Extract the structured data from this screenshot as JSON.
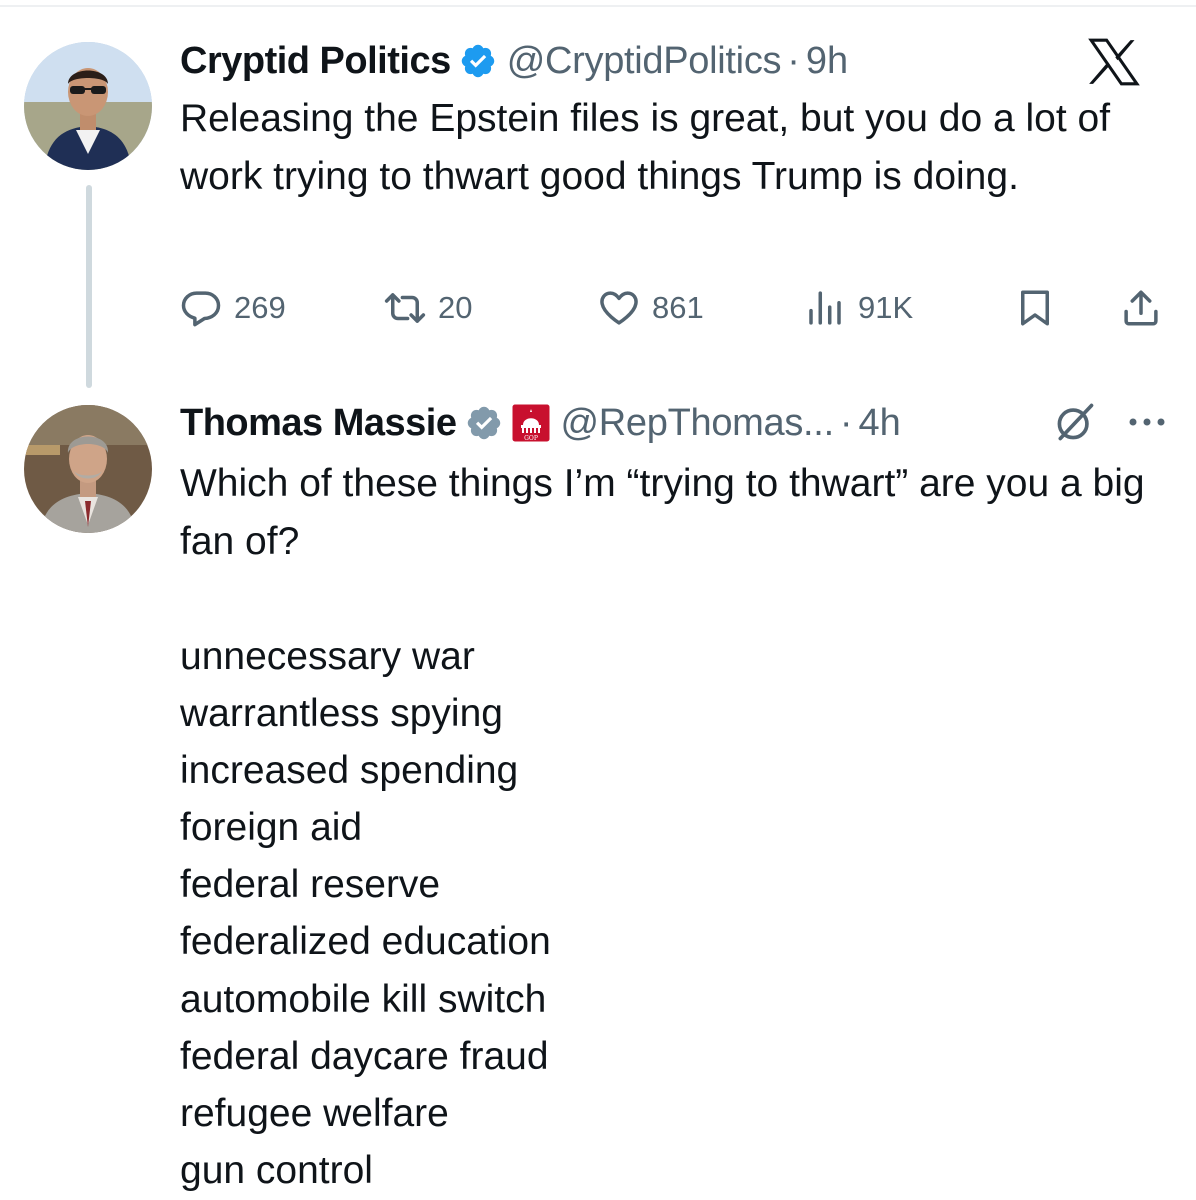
{
  "tweet1": {
    "name": "Cryptid Politics",
    "handle": "@CryptidPolitics",
    "separator": "·",
    "time": "9h",
    "text": "Releasing the Epstein files is great, but you do a lot of work trying to thwart good things Trump is doing.",
    "stats": {
      "replies": "269",
      "reposts": "20",
      "likes": "861",
      "views": "91K"
    }
  },
  "tweet2": {
    "name": "Thomas Massie",
    "handle": "@RepThomas...",
    "separator": "·",
    "time": "4h",
    "text": "Which of these things I’m “trying to thwart” are you a big fan of?",
    "list_items": [
      "unnecessary war",
      "warrantless spying",
      "increased spending",
      "foreign aid",
      "federal reserve",
      "federalized education",
      "automobile kill switch",
      "federal daycare fraud",
      "refugee welfare",
      "gun control"
    ],
    "badge_text": "GOP"
  },
  "colors": {
    "verified_blue": "#1d9bf0",
    "verified_gray": "#829aab",
    "gov_red": "#c8102e",
    "muted": "#536471",
    "text": "#0f1419"
  },
  "icons": [
    "x-logo-icon",
    "verified-badge-icon",
    "reply-icon",
    "repost-icon",
    "like-icon",
    "views-icon",
    "bookmark-icon",
    "share-icon",
    "grok-icon",
    "more-icon",
    "gov-badge-icon"
  ]
}
